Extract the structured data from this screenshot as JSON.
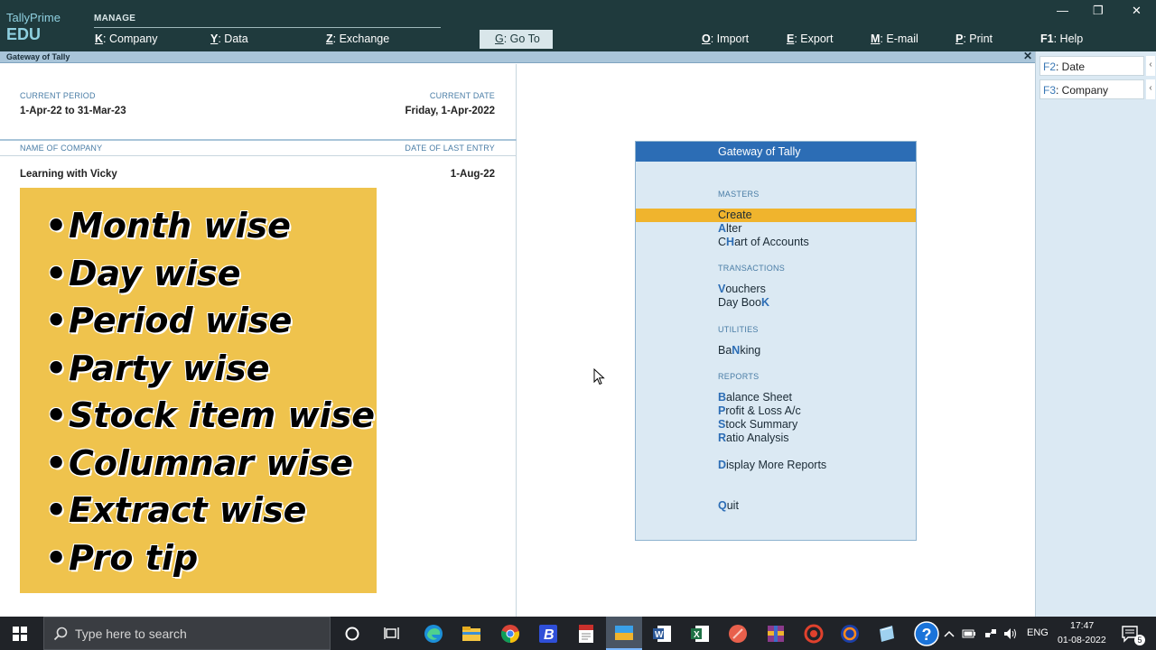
{
  "brand": {
    "line1": "TallyPrime",
    "line2": "EDU"
  },
  "topmenu": {
    "manage_label": "MANAGE",
    "company": {
      "key": "K",
      "label": ": Company"
    },
    "data": {
      "key": "Y",
      "label": ": Data"
    },
    "exchange": {
      "key": "Z",
      "label": ": Exchange"
    },
    "goto": {
      "key": "G",
      "label": ": Go To"
    },
    "import": {
      "key": "O",
      "label": ": Import"
    },
    "export": {
      "key": "E",
      "label": ": Export"
    },
    "email": {
      "key": "M",
      "label": ": E-mail"
    },
    "print": {
      "key": "P",
      "label": ": Print"
    },
    "help": {
      "key": "F1",
      "label": ": Help"
    }
  },
  "window": {
    "minimize": "—",
    "restore": "❐",
    "close": "✕"
  },
  "gateway_bar": {
    "title": "Gateway of Tally",
    "close": "✕"
  },
  "period": {
    "current_period_label": "CURRENT PERIOD",
    "current_period": "1-Apr-22 to 31-Mar-23",
    "current_date_label": "CURRENT DATE",
    "current_date": "Friday, 1-Apr-2022",
    "name_of_company_label": "NAME OF COMPANY",
    "date_of_last_entry_label": "DATE OF LAST ENTRY",
    "company_name": "Learning with Vicky",
    "last_entry": "1-Aug-22"
  },
  "overlay": {
    "items": [
      "Month wise",
      "Day wise",
      "Period wise",
      "Party wise",
      "Stock item wise",
      "Columnar wise",
      "Extract wise",
      "Pro tip"
    ],
    "bg_color": "#efc34d"
  },
  "sidebar": {
    "date": {
      "key": "F2",
      "label": ": Date"
    },
    "company": {
      "key": "F3",
      "label": ": Company"
    },
    "arrow": "‹"
  },
  "gateway_menu": {
    "title": "Gateway of Tally",
    "masters_label": "MASTERS",
    "create": {
      "key": "",
      "rest": "Create"
    },
    "alter": {
      "key": "A",
      "rest": "lter"
    },
    "chart": {
      "pre": "C",
      "key": "H",
      "rest": "art of Accounts"
    },
    "transactions_label": "TRANSACTIONS",
    "vouchers": {
      "key": "V",
      "rest": "ouchers"
    },
    "daybook": {
      "pre": "Day Boo",
      "key": "K",
      "rest": ""
    },
    "utilities_label": "UTILITIES",
    "banking": {
      "pre": "Ba",
      "key": "N",
      "rest": "king"
    },
    "reports_label": "REPORTS",
    "balance": {
      "key": "B",
      "rest": "alance Sheet"
    },
    "profit": {
      "key": "P",
      "rest": "rofit & Loss A/c"
    },
    "stock": {
      "key": "S",
      "rest": "tock Summary"
    },
    "ratio": {
      "key": "R",
      "rest": "atio Analysis"
    },
    "display": {
      "key": "D",
      "rest": "isplay More Reports"
    },
    "quit": {
      "key": "Q",
      "rest": "uit"
    }
  },
  "taskbar": {
    "search_placeholder": "Type here to search",
    "lang": "ENG",
    "time": "17:47",
    "date": "01-08-2022",
    "notif_count": "5"
  }
}
